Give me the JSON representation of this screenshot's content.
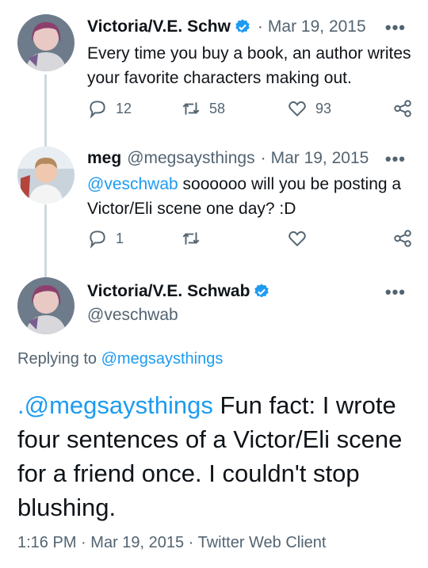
{
  "tweet1": {
    "name": "Victoria/V.E. Schw",
    "separator": "·",
    "date": "Mar 19, 2015",
    "text": "Every time you buy a book, an author writes your favorite characters making out.",
    "replies": "12",
    "retweets": "58",
    "likes": "93",
    "avatar_icon": "avatar-purple-hair"
  },
  "tweet2": {
    "name": "meg",
    "handle": "@megsaysthings",
    "separator": "·",
    "date": "Mar 19, 2015",
    "mention": "@veschwab",
    "text": " soooooo will you be posting a Victor/Eli scene one day? :D",
    "replies": "1",
    "avatar_icon": "avatar-child-photo"
  },
  "tweet3": {
    "name": "Victoria/V.E. Schwab",
    "handle": "@veschwab",
    "replying_prefix": "Replying to ",
    "replying_to": "@megsaysthings",
    "mention": ".@megsaysthings",
    "text": " Fun fact: I wrote four sentences of a Victor/Eli scene for a friend once. I couldn't stop blushing.",
    "time": "1:16 PM",
    "date": "Mar 19, 2015",
    "client": "Twitter Web Client",
    "separator": "·"
  },
  "colors": {
    "accent": "#1d9bf0",
    "secondary_text": "#536471",
    "primary_text": "#0f1419"
  }
}
